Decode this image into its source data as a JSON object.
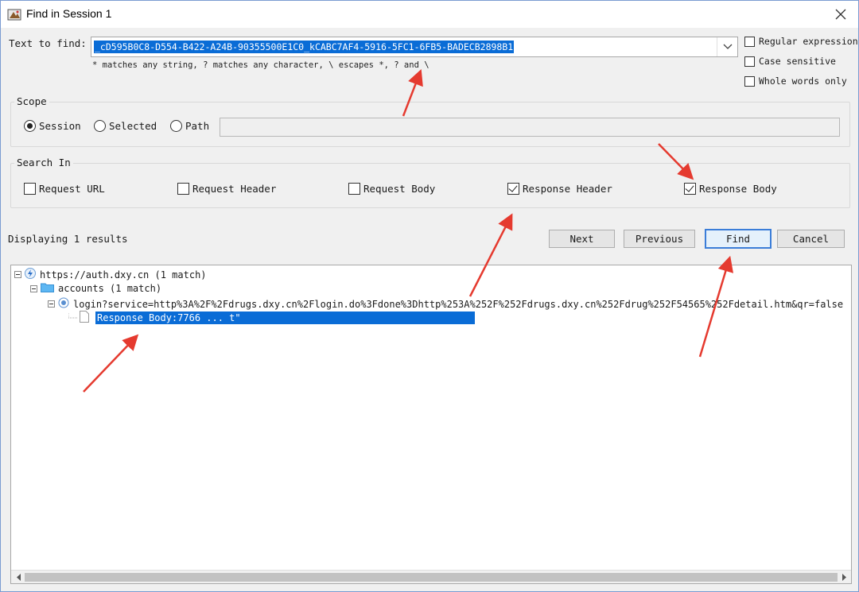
{
  "window": {
    "title": "Find in Session 1"
  },
  "find": {
    "label": "Text to find:",
    "value": "_cD595B0C8-D554-B422-A24B-90355500E1C0_kCABC7AF4-5916-5FC1-6FB5-BADECB2898B1",
    "hint": "* matches any string, ? matches any character, \\ escapes *, ? and \\"
  },
  "options": {
    "regex": "Regular expression",
    "case": "Case sensitive",
    "whole": "Whole words only"
  },
  "scope": {
    "title": "Scope",
    "session": "Session",
    "selected": "Selected",
    "path": "Path",
    "path_value": ""
  },
  "search_in": {
    "title": "Search In",
    "items": [
      {
        "label": "Request URL",
        "checked": false
      },
      {
        "label": "Request Header",
        "checked": false
      },
      {
        "label": "Request Body",
        "checked": false
      },
      {
        "label": "Response Header",
        "checked": true
      },
      {
        "label": "Response Body",
        "checked": true
      }
    ]
  },
  "results": {
    "status": "Displaying 1 results"
  },
  "buttons": {
    "next": "Next",
    "previous": "Previous",
    "find": "Find",
    "cancel": "Cancel"
  },
  "tree": {
    "host": "https://auth.dxy.cn (1 match)",
    "folder": "accounts (1 match)",
    "request": "login?service=http%3A%2F%2Fdrugs.dxy.cn%2Flogin.do%3Fdone%3Dhttp%253A%252F%252Fdrugs.dxy.cn%252Fdrug%252F54565%252Fdetail.htm&qr=false",
    "match": "Response Body:7766      ...  t\""
  },
  "colors": {
    "selection": "#0a6cd6",
    "arrow": "#e53a2f",
    "default_button_border": "#3b7dd8"
  }
}
